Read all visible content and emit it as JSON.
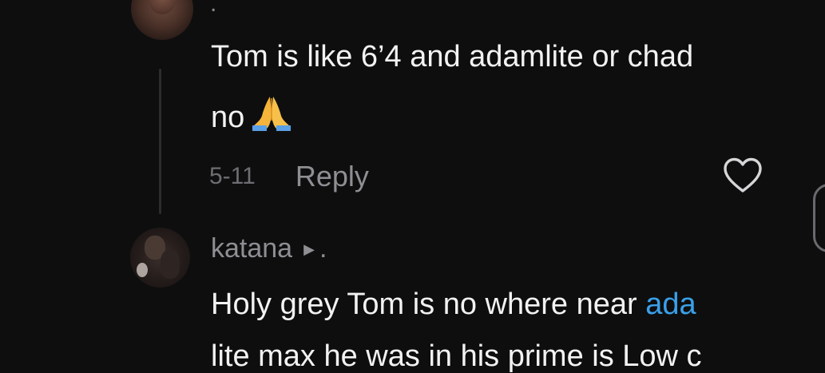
{
  "comments": [
    {
      "username": ".",
      "lines": [
        "Tom is like 6’4 and adamlite or chad",
        "no"
      ],
      "emoji": "folded-hands-emoji",
      "date": "5-11",
      "reply_label": "Reply",
      "like_icon": "heart-outline-icon"
    },
    {
      "username": "katana",
      "username_suffix": ".",
      "play_icon": "play-triangle-icon",
      "line1_plain": "Holy grey Tom is no where near ",
      "line1_mention": "ada",
      "line2": "lite max he was in his prime is Low c"
    }
  ],
  "colors": {
    "background": "#0e0e0f",
    "text": "#f2f2f2",
    "muted": "#8e8e93",
    "mention": "#3aa0e8"
  }
}
